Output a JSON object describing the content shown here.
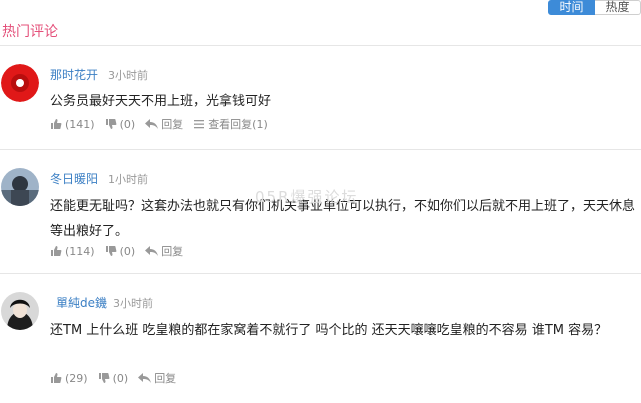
{
  "header": {
    "section_title": "热门评论",
    "tabs": [
      {
        "label": "时间",
        "active": true
      },
      {
        "label": "热度",
        "active": false
      }
    ]
  },
  "accent_colors": {
    "title": "#e4507a",
    "active_tab": "#3d8bd8",
    "username": "#3b7fc4"
  },
  "comments": [
    {
      "username": "那时花开",
      "time": "3小时前",
      "text": "公务员最好天天不用上班，光拿钱可好",
      "likes": "(141)",
      "dislikes": "(0)",
      "reply": "回复",
      "view_replies": "查看回复(1)"
    },
    {
      "username": "冬日暖阳",
      "time": "1小时前",
      "text": "还能更无耻吗？这套办法也就只有你们机关事业单位可以执行，不如你们以后就不用上班了，天天休息等出粮好了。",
      "likes": "(114)",
      "dislikes": "(0)",
      "reply": "回复"
    },
    {
      "username": "單純de鐖",
      "time": "3小时前",
      "text": "还TM 上什么班 吃皇粮的都在家窝着不就行了 吗个比的 还天天嚷嚷吃皇粮的不容易 谁TM 容易？",
      "likes": "(29)",
      "dislikes": "(0)",
      "reply": "回复"
    }
  ],
  "watermark": "05R爆强论坛"
}
